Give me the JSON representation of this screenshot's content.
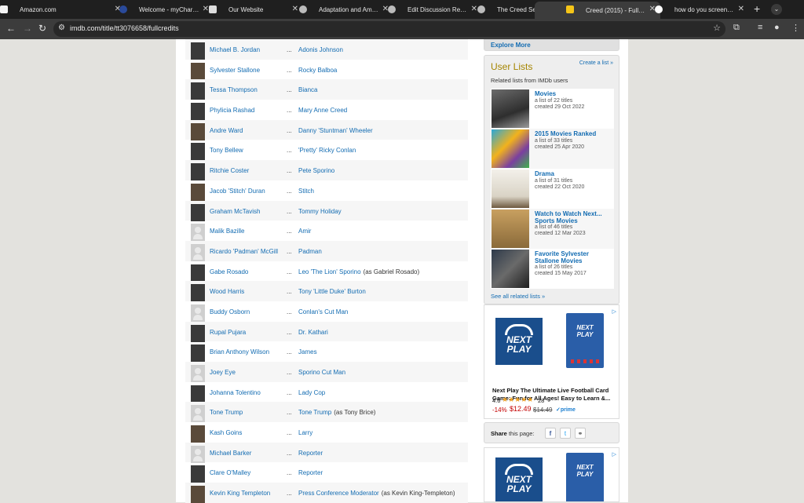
{
  "browser": {
    "tabs": [
      {
        "title": "Amazon.com"
      },
      {
        "title": "Welcome - myCharger"
      },
      {
        "title": "Our Website"
      },
      {
        "title": "Adaptation and Amuse"
      },
      {
        "title": "Edit Discussion Reflec"
      },
      {
        "title": "The Creed Series – Alo"
      },
      {
        "title": "Creed (2015) - Full Ca"
      },
      {
        "title": "how do you screensho"
      }
    ],
    "url": "imdb.com/title/tt3076658/fullcredits"
  },
  "cast": [
    {
      "name": "Michael B. Jordan",
      "character": "Adonis Johnson",
      "note": ""
    },
    {
      "name": "Sylvester Stallone",
      "character": "Rocky Balboa",
      "note": ""
    },
    {
      "name": "Tessa Thompson",
      "character": "Bianca",
      "note": ""
    },
    {
      "name": "Phylicia Rashad",
      "character": "Mary Anne Creed",
      "note": ""
    },
    {
      "name": "Andre Ward",
      "character": "Danny 'Stuntman' Wheeler",
      "note": ""
    },
    {
      "name": "Tony Bellew",
      "character": "'Pretty' Ricky Conlan",
      "note": ""
    },
    {
      "name": "Ritchie Coster",
      "character": "Pete Sporino",
      "note": ""
    },
    {
      "name": "Jacob 'Stitch' Duran",
      "character": "Stitch",
      "note": ""
    },
    {
      "name": "Graham McTavish",
      "character": "Tommy Holiday",
      "note": ""
    },
    {
      "name": "Malik Bazille",
      "character": "Amir",
      "note": ""
    },
    {
      "name": "Ricardo 'Padman' McGill",
      "character": "Padman",
      "note": ""
    },
    {
      "name": "Gabe Rosado",
      "character": "Leo 'The Lion' Sporino",
      "note": "(as Gabriel Rosado)"
    },
    {
      "name": "Wood Harris",
      "character": "Tony 'Little Duke' Burton",
      "note": ""
    },
    {
      "name": "Buddy Osborn",
      "character": "Conlan's Cut Man",
      "note": ""
    },
    {
      "name": "Rupal Pujara",
      "character": "Dr. Kathari",
      "note": ""
    },
    {
      "name": "Brian Anthony Wilson",
      "character": "James",
      "note": ""
    },
    {
      "name": "Joey Eye",
      "character": "Sporino Cut Man",
      "note": ""
    },
    {
      "name": "Johanna Tolentino",
      "character": "Lady Cop",
      "note": ""
    },
    {
      "name": "Tone Trump",
      "character": "Tone Trump",
      "note": "(as Tony Brice)"
    },
    {
      "name": "Kash Goins",
      "character": "Larry",
      "note": ""
    },
    {
      "name": "Michael Barker",
      "character": "Reporter",
      "note": ""
    },
    {
      "name": "Clare O'Malley",
      "character": "Reporter",
      "note": ""
    },
    {
      "name": "Kevin King Templeton",
      "character": "Press Conference Moderator",
      "note": "(as Kevin King-Templeton)"
    }
  ],
  "dots": "...",
  "sidebar": {
    "explore_more": "Explore More",
    "user_lists": {
      "heading": "User Lists",
      "create": "Create a list »",
      "subheading": "Related lists from IMDb users",
      "lists": [
        {
          "title": "Movies",
          "count": "a list of 22 titles",
          "created": "created 29 Oct 2022"
        },
        {
          "title": "2015 Movies Ranked",
          "count": "a list of 33 titles",
          "created": "created 25 Apr 2020"
        },
        {
          "title": "Drama",
          "count": "a list of 31 titles",
          "created": "created 22 Oct 2020"
        },
        {
          "title": "Watch to Watch Next... Sports Movies",
          "count": "a list of 46 titles",
          "created": "created 12 Mar 2023"
        },
        {
          "title": "Favorite Sylvester Stallone Movies",
          "count": "a list of 26 titles",
          "created": "created 15 May 2017"
        }
      ],
      "see_all": "See all related lists »"
    },
    "ad": {
      "logo_text": "NEXT PLAY",
      "box_text": "NEXT PLAY",
      "title": "Next Play The Ultimate Live Football Card Game: Fun for All Ages! Easy to Learn &...",
      "rating": "4.6",
      "stars": "★★★★★",
      "reviews": "28",
      "discount": "-14%",
      "price": "$12.49",
      "was": "$14.49",
      "prime": "✓prime",
      "info": "▷"
    },
    "share": {
      "label": "Share",
      "rest": " this page:"
    }
  }
}
